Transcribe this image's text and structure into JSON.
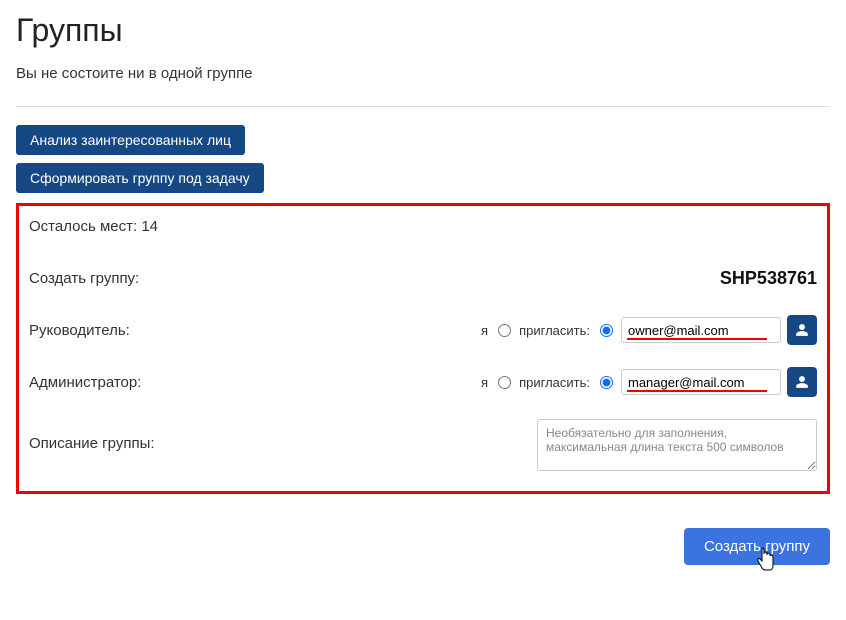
{
  "page": {
    "title": "Группы",
    "no_groups_message": "Вы не состоите ни в одной группе"
  },
  "buttons": {
    "stakeholder_analysis": "Анализ заинтересованных лиц",
    "form_task_group": "Сформировать группу под задачу",
    "create_group": "Создать группу"
  },
  "form": {
    "slots_left_label": "Осталось мест: 14",
    "create_label": "Создать группу:",
    "group_id": "SHP538761",
    "owner": {
      "label": "Руководитель:",
      "me_label": "я",
      "me_selected": false,
      "invite_label": "пригласить:",
      "invite_selected": true,
      "email": "owner@mail.com"
    },
    "admin": {
      "label": "Администратор:",
      "me_label": "я",
      "me_selected": false,
      "invite_label": "пригласить:",
      "invite_selected": true,
      "email": "manager@mail.com"
    },
    "description": {
      "label": "Описание группы:",
      "placeholder": "Необязательно для заполнения, максимальная длина текста 500 символов",
      "value": ""
    }
  }
}
